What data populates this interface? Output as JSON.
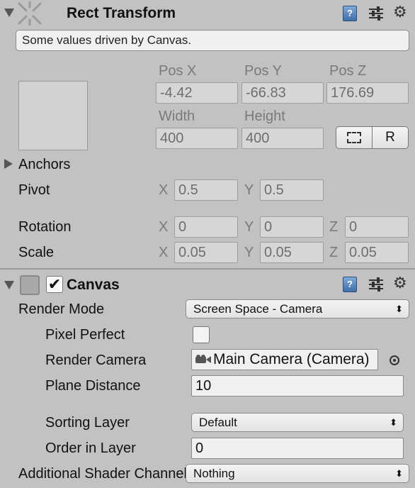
{
  "rect_transform": {
    "title": "Rect Transform",
    "info": "Some values driven by Canvas.",
    "pos_x_label": "Pos X",
    "pos_y_label": "Pos Y",
    "pos_z_label": "Pos Z",
    "pos_x": "-4.42",
    "pos_y": "-66.83",
    "pos_z": "176.69",
    "width_label": "Width",
    "height_label": "Height",
    "width": "400",
    "height": "400",
    "raw_button": "R",
    "anchors_label": "Anchors",
    "pivot_label": "Pivot",
    "pivot": {
      "x_label": "X",
      "x": "0.5",
      "y_label": "Y",
      "y": "0.5"
    },
    "rotation_label": "Rotation",
    "rotation": {
      "x_label": "X",
      "x": "0",
      "y_label": "Y",
      "y": "0",
      "z_label": "Z",
      "z": "0"
    },
    "scale_label": "Scale",
    "scale": {
      "x_label": "X",
      "x": "0.05",
      "y_label": "Y",
      "y": "0.05",
      "z_label": "Z",
      "z": "0.05"
    }
  },
  "canvas": {
    "title": "Canvas",
    "enabled": true,
    "render_mode_label": "Render Mode",
    "render_mode": "Screen Space - Camera",
    "pixel_perfect_label": "Pixel Perfect",
    "pixel_perfect": false,
    "render_camera_label": "Render Camera",
    "render_camera": "Main Camera (Camera)",
    "plane_distance_label": "Plane Distance",
    "plane_distance": "10",
    "sorting_layer_label": "Sorting Layer",
    "sorting_layer": "Default",
    "order_in_layer_label": "Order in Layer",
    "order_in_layer": "0",
    "additional_shader_label": "Additional Shader Channels",
    "additional_shader": "Nothing"
  },
  "icons": {
    "help": "help-book-icon",
    "presets": "presets-sliders-icon",
    "settings": "gear-icon",
    "rect_tool": "rect-transform-icon",
    "camera": "camera-icon",
    "object_picker": "object-picker-icon"
  }
}
